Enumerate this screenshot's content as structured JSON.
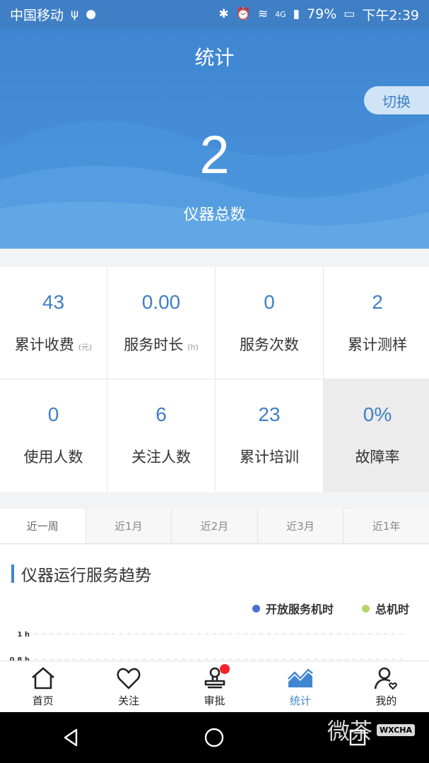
{
  "status_bar": {
    "carrier": "中国移动",
    "network": "4G",
    "battery": "79%",
    "time": "下午2:39"
  },
  "header": {
    "title": "统计",
    "switch_label": "切换",
    "total_count": "2",
    "total_label": "仪器总数"
  },
  "stats": [
    {
      "value": "43",
      "label": "累计收费",
      "unit": "(元)"
    },
    {
      "value": "0.00",
      "label": "服务时长",
      "unit": "(h)"
    },
    {
      "value": "0",
      "label": "服务次数",
      "unit": ""
    },
    {
      "value": "2",
      "label": "累计测样",
      "unit": ""
    },
    {
      "value": "0",
      "label": "使用人数",
      "unit": ""
    },
    {
      "value": "6",
      "label": "关注人数",
      "unit": ""
    },
    {
      "value": "23",
      "label": "累计培训",
      "unit": ""
    },
    {
      "value": "0%",
      "label": "故障率",
      "unit": ""
    }
  ],
  "range_tabs": [
    "近一周",
    "近1月",
    "近2月",
    "近3月",
    "近1年"
  ],
  "chart": {
    "title": "仪器运行服务趋势",
    "legend": [
      {
        "name": "开放服务机时",
        "color": "#4a6fd4"
      },
      {
        "name": "总机时",
        "color": "#b5d56a"
      }
    ]
  },
  "chart_data": {
    "type": "line",
    "title": "仪器运行服务趋势",
    "y_ticks": [
      "1 h",
      "0.8 h"
    ],
    "series": [
      {
        "name": "开放服务机时",
        "values": []
      },
      {
        "name": "总机时",
        "values": []
      }
    ],
    "legend_position": "top-right"
  },
  "tab_bar": [
    {
      "label": "首页",
      "icon": "home-icon"
    },
    {
      "label": "关注",
      "icon": "heart-icon"
    },
    {
      "label": "审批",
      "icon": "stamp-icon"
    },
    {
      "label": "统计",
      "icon": "chart-icon"
    },
    {
      "label": "我的",
      "icon": "user-icon"
    }
  ],
  "watermark": {
    "text": "微茶",
    "tag": "WXCHA"
  },
  "colors": {
    "primary": "#3f86d1",
    "accent_light": "#cfe4f6",
    "badge": "#f5222d"
  }
}
